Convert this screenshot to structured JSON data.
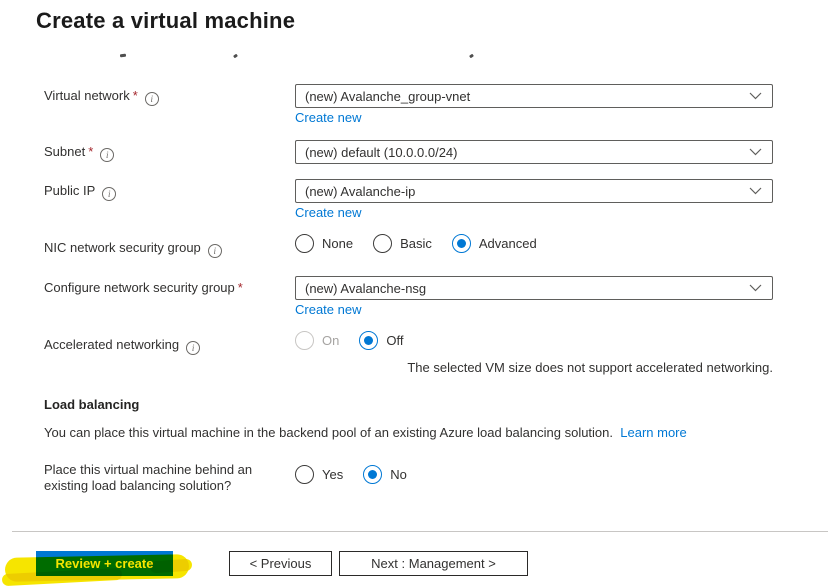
{
  "page": {
    "title": "Create a virtual machine"
  },
  "colors": {
    "accent": "#0078d4",
    "link": "#0078d4",
    "required_asterisk": "#a4262c",
    "highlighter_yellow": "#f6e500"
  },
  "icons": {
    "info": "i",
    "chevron_down": "chevron-down"
  },
  "fields": {
    "virtual_network": {
      "label": "Virtual network",
      "required": "*",
      "value": "(new) Avalanche_group-vnet",
      "create_new": "Create new"
    },
    "subnet": {
      "label": "Subnet",
      "required": "*",
      "value": "(new) default (10.0.0.0/24)"
    },
    "public_ip": {
      "label": "Public IP",
      "value": "(new) Avalanche-ip",
      "create_new": "Create new"
    },
    "nic_nsg": {
      "label": "NIC network security group",
      "options": [
        {
          "label": "None",
          "selected": false
        },
        {
          "label": "Basic",
          "selected": false
        },
        {
          "label": "Advanced",
          "selected": true
        }
      ]
    },
    "configure_nsg": {
      "label": "Configure network security group",
      "required": "*",
      "value": "(new) Avalanche-nsg",
      "create_new": "Create new"
    },
    "accelerated_networking": {
      "label": "Accelerated networking",
      "options": [
        {
          "label": "On",
          "selected": false,
          "disabled": true
        },
        {
          "label": "Off",
          "selected": true
        }
      ],
      "note": "The selected VM size does not support accelerated networking."
    }
  },
  "load_balancing": {
    "heading": "Load balancing",
    "description": "You can place this virtual machine in the backend pool of an existing Azure load balancing solution.",
    "learn_more": "Learn more",
    "question_line1": "Place this virtual machine behind an",
    "question_line2": "existing load balancing solution?",
    "options": [
      {
        "label": "Yes",
        "selected": false
      },
      {
        "label": "No",
        "selected": true
      }
    ]
  },
  "footer": {
    "review_create": "Review + create",
    "previous": "< Previous",
    "next": "Next : Management >"
  }
}
